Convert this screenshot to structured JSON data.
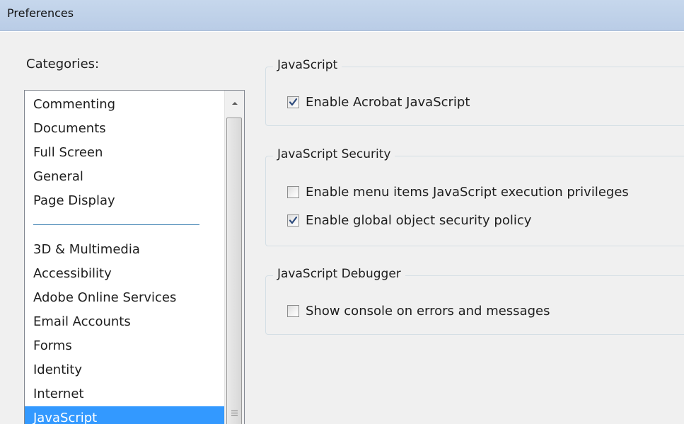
{
  "window": {
    "title": "Preferences"
  },
  "categories": {
    "label": "Categories:",
    "group_a": [
      "Commenting",
      "Documents",
      "Full Screen",
      "General",
      "Page Display"
    ],
    "group_b": [
      "3D & Multimedia",
      "Accessibility",
      "Adobe Online Services",
      "Email Accounts",
      "Forms",
      "Identity",
      "Internet",
      "JavaScript"
    ],
    "selected": "JavaScript"
  },
  "groups": {
    "javascript": {
      "title": "JavaScript",
      "enable_acrobat_js": {
        "label": "Enable Acrobat JavaScript",
        "checked": true
      }
    },
    "security": {
      "title": "JavaScript Security",
      "menu_items_privileges": {
        "label": "Enable menu items JavaScript execution privileges",
        "checked": false
      },
      "global_object_policy": {
        "label": "Enable global object security policy",
        "checked": true
      }
    },
    "debugger": {
      "title": "JavaScript Debugger",
      "show_console": {
        "label": "Show console on errors and messages",
        "checked": false
      }
    }
  },
  "icons": {
    "scroll_up": "scroll-up-arrow-icon",
    "checkmark": "checkmark-icon",
    "grip": "scroll-thumb-grip-icon"
  },
  "colors": {
    "selection": "#3399ff",
    "titlebar": "#b9cce6",
    "separator": "#3c7fb1"
  }
}
